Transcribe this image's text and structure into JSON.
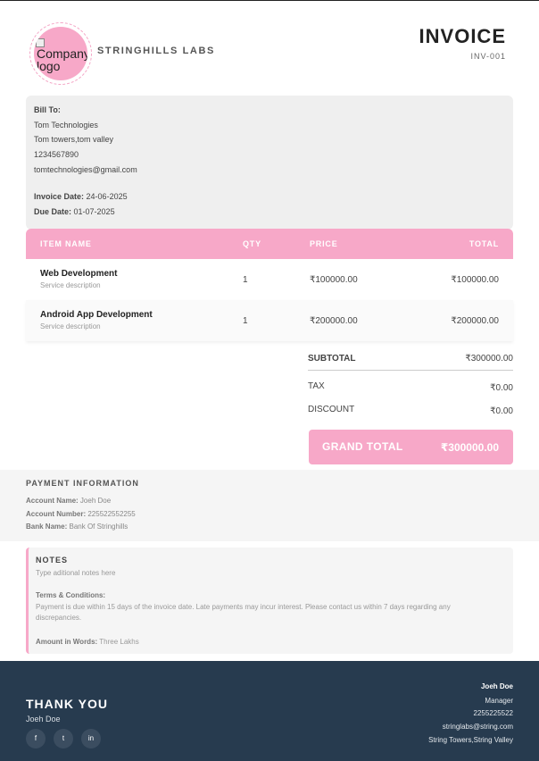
{
  "header": {
    "logo_alt": "Company logo",
    "company_name": "STRINGHILLS LABS",
    "title": "INVOICE",
    "invoice_number": "INV-001"
  },
  "bill_to": {
    "label": "Bill To:",
    "name": "Tom Technologies",
    "address": "Tom towers,tom valley",
    "phone": "1234567890",
    "email": "tomtechnologies@gmail.com",
    "invoice_date_label": "Invoice Date:",
    "invoice_date": "24-06-2025",
    "due_date_label": "Due Date:",
    "due_date": "01-07-2025"
  },
  "table": {
    "headers": [
      "ITEM NAME",
      "QTY",
      "PRICE",
      "TOTAL"
    ],
    "rows": [
      {
        "name": "Web Development",
        "description": "Service description",
        "qty": "1",
        "price": "₹100000.00",
        "total": "₹100000.00"
      },
      {
        "name": "Android App Development",
        "description": "Service description",
        "qty": "1",
        "price": "₹200000.00",
        "total": "₹200000.00"
      }
    ]
  },
  "totals": {
    "subtotal_label": "SUBTOTAL",
    "subtotal": "₹300000.00",
    "tax_label": "TAX",
    "tax": "₹0.00",
    "discount_label": "DISCOUNT",
    "discount": "₹0.00",
    "grand_total_label": "GRAND TOTAL",
    "grand_total": "₹300000.00"
  },
  "payment": {
    "title": "PAYMENT INFORMATION",
    "account_name_label": "Account Name:",
    "account_name": "Joeh Doe",
    "account_number_label": "Account Number:",
    "account_number": "225522552255",
    "bank_name_label": "Bank Name:",
    "bank_name": "Bank Of Stringhills"
  },
  "notes": {
    "title": "NOTES",
    "placeholder_text": "Type aditional notes here",
    "terms_label": "Terms & Conditions:",
    "terms_line1": "Payment is due within 15 days of the invoice date. Late payments may incur interest. Please contact us within 7 days regarding any",
    "terms_line2": "discrepancies.",
    "amount_words_label": "Amount in Words:",
    "amount_words": "Three Lakhs"
  },
  "footer": {
    "thank_you": "THANK YOU",
    "signer_name": "Joeh Doe",
    "social": [
      "f",
      "t",
      "in"
    ],
    "contact_name": "Joeh Doe",
    "contact_role": "Manager",
    "contact_phone": "2255225522",
    "contact_email": "stringlabs@string.com",
    "contact_address": "String Towers,String Valley"
  },
  "colors": {
    "accent_pink": "#f7a8c8",
    "footer_navy": "#273b4f"
  }
}
